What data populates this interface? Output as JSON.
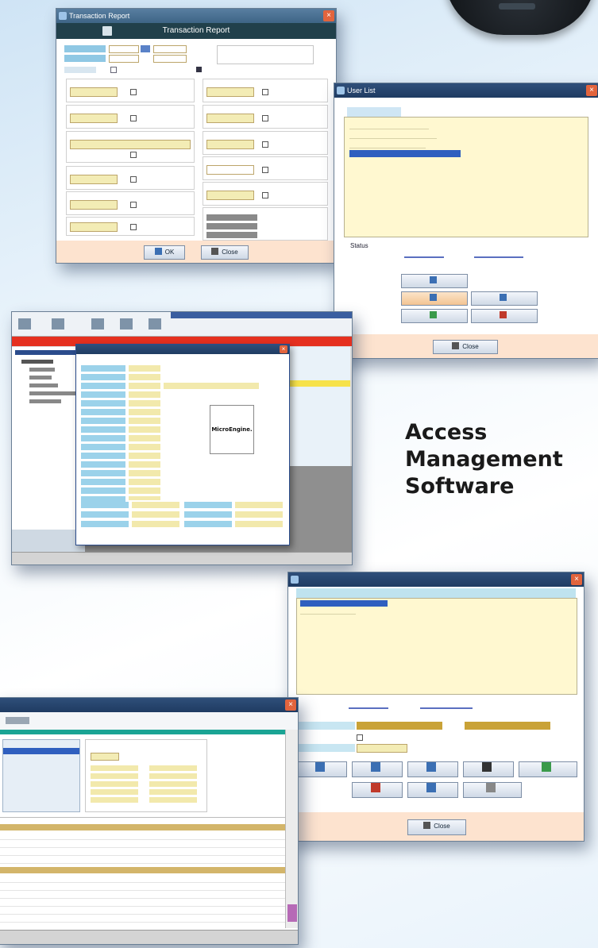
{
  "headline": [
    "Access",
    "Management",
    "Software"
  ],
  "colors": {
    "titlebar": "#1f3b62",
    "footer": "#fde3cf",
    "field_yellow": "#f3ecb5",
    "selection": "#2f5fbf"
  },
  "transaction_report": {
    "window_title": "Transaction Report",
    "header": "Transaction Report",
    "ok_label": "OK",
    "close_label": "Close"
  },
  "user_list_window": {
    "window_title": "User List",
    "list_items": [
      "",
      "",
      "",
      ""
    ],
    "status_label": "Status",
    "link_1": "",
    "link_2": "",
    "add_label": "",
    "open_label": "",
    "unlock_label": "",
    "lock_label": "",
    "delete_label": "",
    "close_label": "Close"
  },
  "main_app": {
    "logo_text": "MicroEngine."
  },
  "card_window": {
    "window_title": "",
    "header": "",
    "status_label": "",
    "close_label": "Close"
  },
  "ledger_window": {}
}
